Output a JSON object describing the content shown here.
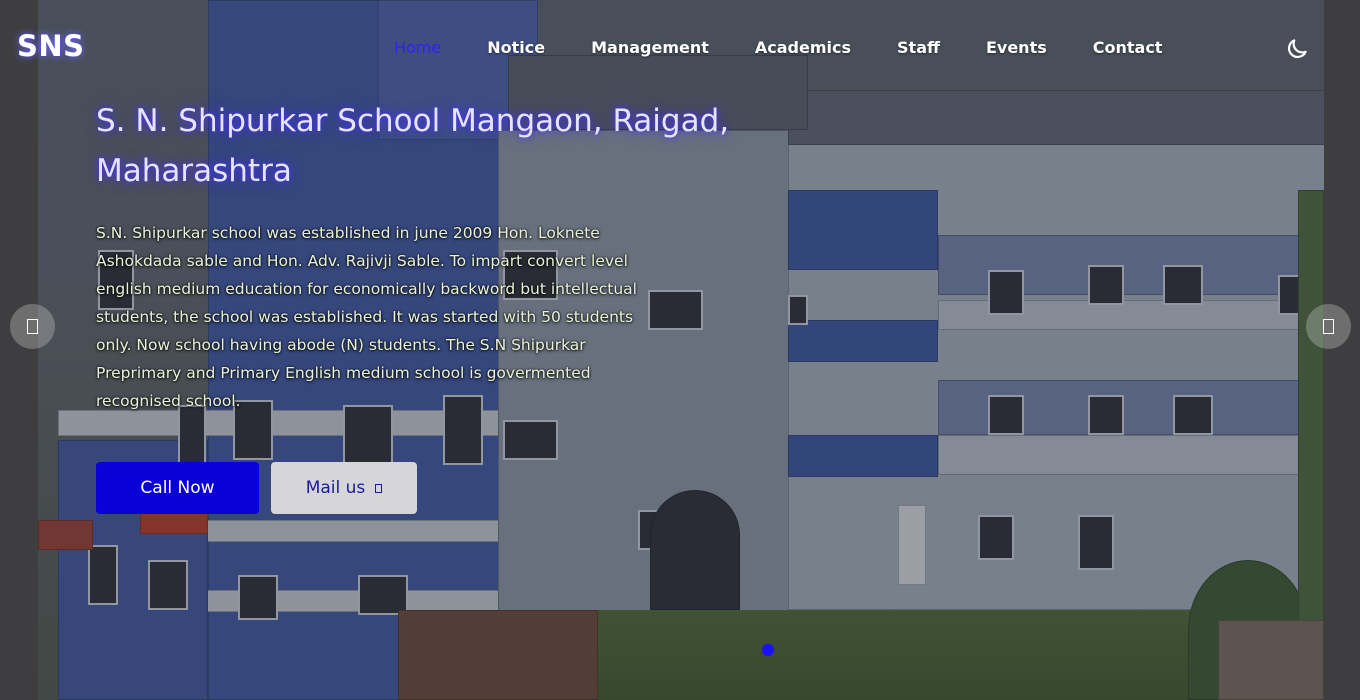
{
  "brand": {
    "name": "SNS"
  },
  "nav": {
    "items": [
      {
        "label": "Home",
        "active": true
      },
      {
        "label": "Notice"
      },
      {
        "label": "Management"
      },
      {
        "label": "Academics"
      },
      {
        "label": "Staff"
      },
      {
        "label": "Events"
      },
      {
        "label": "Contact"
      }
    ],
    "theme_toggle_icon": "moon-icon"
  },
  "hero": {
    "title": "S. N. Shipurkar School Mangaon, Raigad, Maharashtra",
    "description": "S.N. Shipurkar school was established in june 2009 Hon. Loknete Ashokdada sable and Hon. Adv. Rajivji Sable. To impart convert level english medium education for economically backword but intellectual students, the school was established. It was started with 50 students only. Now school having abode (N) students. The S.N Shipurkar Preprimary and Primary English medium school is govermented recognised school.",
    "call_label": "Call Now",
    "mail_label": "Mail us",
    "mail_icon": "mail-icon"
  },
  "carousel": {
    "prev_icon": "chevron-left-icon",
    "next_icon": "chevron-right-icon",
    "active_index": 0
  },
  "colors": {
    "accent": "#0a00d8",
    "nav_active": "#2f1fff",
    "title_glow": "#4632ff",
    "mail_button": "#d6d6d8"
  }
}
